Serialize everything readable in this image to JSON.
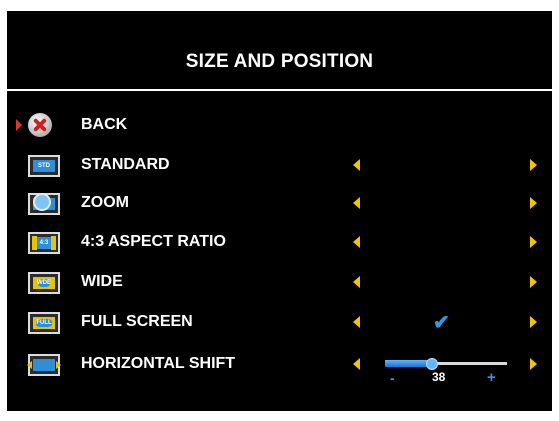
{
  "colors": {
    "background": "#000000",
    "text": "#ffffff",
    "arrow": "#f4c400",
    "selection_marker": "#d9382b",
    "accent": "#2e9be8"
  },
  "menu": {
    "title": "SIZE AND POSITION",
    "items": [
      {
        "label": "BACK",
        "icon": "back-x-icon",
        "selected": true
      },
      {
        "label": "STANDARD",
        "icon": "standard-tv-icon",
        "icon_text": "STD"
      },
      {
        "label": "ZOOM",
        "icon": "zoom-tv-icon"
      },
      {
        "label": "4:3 ASPECT RATIO",
        "icon": "aspect-4-3-tv-icon",
        "icon_text": "4:3"
      },
      {
        "label": "WIDE",
        "icon": "wide-tv-icon",
        "icon_text": "WDE"
      },
      {
        "label": "FULL SCREEN",
        "icon": "full-screen-tv-icon",
        "icon_text": "FULL",
        "checked": true
      },
      {
        "label": "HORIZONTAL SHIFT",
        "icon": "horizontal-shift-tv-icon",
        "slider": {
          "value": 38,
          "min_label": "-",
          "max_label": "+",
          "min": 0,
          "max": 100
        }
      }
    ]
  }
}
